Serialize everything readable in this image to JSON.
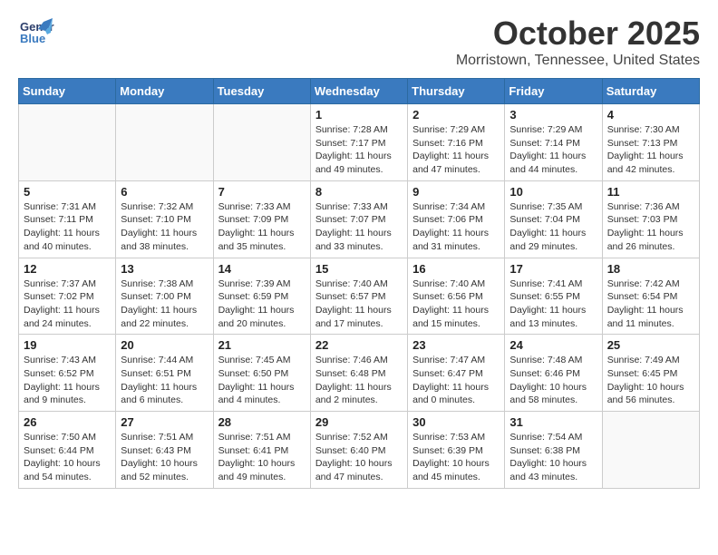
{
  "header": {
    "logo_line1": "General",
    "logo_line2": "Blue",
    "month": "October 2025",
    "location": "Morristown, Tennessee, United States"
  },
  "weekdays": [
    "Sunday",
    "Monday",
    "Tuesday",
    "Wednesday",
    "Thursday",
    "Friday",
    "Saturday"
  ],
  "weeks": [
    [
      {
        "day": "",
        "info": ""
      },
      {
        "day": "",
        "info": ""
      },
      {
        "day": "",
        "info": ""
      },
      {
        "day": "1",
        "info": "Sunrise: 7:28 AM\nSunset: 7:17 PM\nDaylight: 11 hours\nand 49 minutes."
      },
      {
        "day": "2",
        "info": "Sunrise: 7:29 AM\nSunset: 7:16 PM\nDaylight: 11 hours\nand 47 minutes."
      },
      {
        "day": "3",
        "info": "Sunrise: 7:29 AM\nSunset: 7:14 PM\nDaylight: 11 hours\nand 44 minutes."
      },
      {
        "day": "4",
        "info": "Sunrise: 7:30 AM\nSunset: 7:13 PM\nDaylight: 11 hours\nand 42 minutes."
      }
    ],
    [
      {
        "day": "5",
        "info": "Sunrise: 7:31 AM\nSunset: 7:11 PM\nDaylight: 11 hours\nand 40 minutes."
      },
      {
        "day": "6",
        "info": "Sunrise: 7:32 AM\nSunset: 7:10 PM\nDaylight: 11 hours\nand 38 minutes."
      },
      {
        "day": "7",
        "info": "Sunrise: 7:33 AM\nSunset: 7:09 PM\nDaylight: 11 hours\nand 35 minutes."
      },
      {
        "day": "8",
        "info": "Sunrise: 7:33 AM\nSunset: 7:07 PM\nDaylight: 11 hours\nand 33 minutes."
      },
      {
        "day": "9",
        "info": "Sunrise: 7:34 AM\nSunset: 7:06 PM\nDaylight: 11 hours\nand 31 minutes."
      },
      {
        "day": "10",
        "info": "Sunrise: 7:35 AM\nSunset: 7:04 PM\nDaylight: 11 hours\nand 29 minutes."
      },
      {
        "day": "11",
        "info": "Sunrise: 7:36 AM\nSunset: 7:03 PM\nDaylight: 11 hours\nand 26 minutes."
      }
    ],
    [
      {
        "day": "12",
        "info": "Sunrise: 7:37 AM\nSunset: 7:02 PM\nDaylight: 11 hours\nand 24 minutes."
      },
      {
        "day": "13",
        "info": "Sunrise: 7:38 AM\nSunset: 7:00 PM\nDaylight: 11 hours\nand 22 minutes."
      },
      {
        "day": "14",
        "info": "Sunrise: 7:39 AM\nSunset: 6:59 PM\nDaylight: 11 hours\nand 20 minutes."
      },
      {
        "day": "15",
        "info": "Sunrise: 7:40 AM\nSunset: 6:57 PM\nDaylight: 11 hours\nand 17 minutes."
      },
      {
        "day": "16",
        "info": "Sunrise: 7:40 AM\nSunset: 6:56 PM\nDaylight: 11 hours\nand 15 minutes."
      },
      {
        "day": "17",
        "info": "Sunrise: 7:41 AM\nSunset: 6:55 PM\nDaylight: 11 hours\nand 13 minutes."
      },
      {
        "day": "18",
        "info": "Sunrise: 7:42 AM\nSunset: 6:54 PM\nDaylight: 11 hours\nand 11 minutes."
      }
    ],
    [
      {
        "day": "19",
        "info": "Sunrise: 7:43 AM\nSunset: 6:52 PM\nDaylight: 11 hours\nand 9 minutes."
      },
      {
        "day": "20",
        "info": "Sunrise: 7:44 AM\nSunset: 6:51 PM\nDaylight: 11 hours\nand 6 minutes."
      },
      {
        "day": "21",
        "info": "Sunrise: 7:45 AM\nSunset: 6:50 PM\nDaylight: 11 hours\nand 4 minutes."
      },
      {
        "day": "22",
        "info": "Sunrise: 7:46 AM\nSunset: 6:48 PM\nDaylight: 11 hours\nand 2 minutes."
      },
      {
        "day": "23",
        "info": "Sunrise: 7:47 AM\nSunset: 6:47 PM\nDaylight: 11 hours\nand 0 minutes."
      },
      {
        "day": "24",
        "info": "Sunrise: 7:48 AM\nSunset: 6:46 PM\nDaylight: 10 hours\nand 58 minutes."
      },
      {
        "day": "25",
        "info": "Sunrise: 7:49 AM\nSunset: 6:45 PM\nDaylight: 10 hours\nand 56 minutes."
      }
    ],
    [
      {
        "day": "26",
        "info": "Sunrise: 7:50 AM\nSunset: 6:44 PM\nDaylight: 10 hours\nand 54 minutes."
      },
      {
        "day": "27",
        "info": "Sunrise: 7:51 AM\nSunset: 6:43 PM\nDaylight: 10 hours\nand 52 minutes."
      },
      {
        "day": "28",
        "info": "Sunrise: 7:51 AM\nSunset: 6:41 PM\nDaylight: 10 hours\nand 49 minutes."
      },
      {
        "day": "29",
        "info": "Sunrise: 7:52 AM\nSunset: 6:40 PM\nDaylight: 10 hours\nand 47 minutes."
      },
      {
        "day": "30",
        "info": "Sunrise: 7:53 AM\nSunset: 6:39 PM\nDaylight: 10 hours\nand 45 minutes."
      },
      {
        "day": "31",
        "info": "Sunrise: 7:54 AM\nSunset: 6:38 PM\nDaylight: 10 hours\nand 43 minutes."
      },
      {
        "day": "",
        "info": ""
      }
    ]
  ]
}
